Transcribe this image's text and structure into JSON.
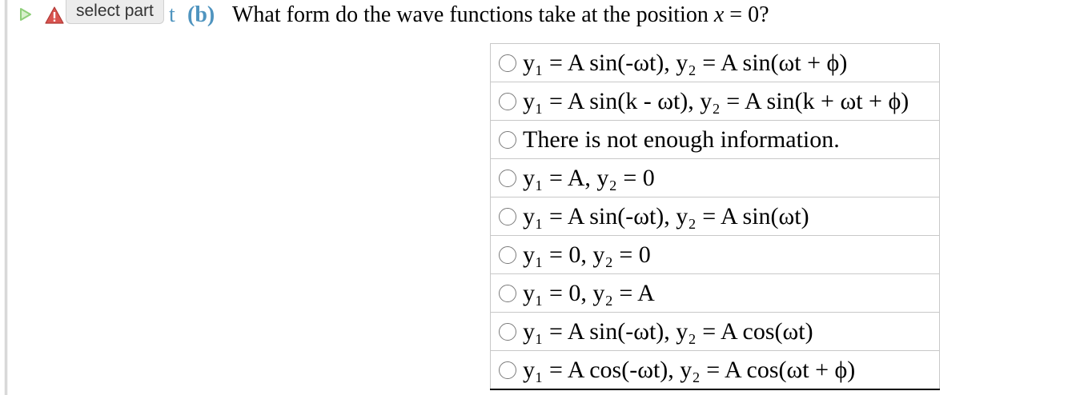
{
  "toolbar": {
    "expand_icon": "play-triangle-icon",
    "warning_icon": "warning-icon",
    "select_part_label": "select part",
    "part_hidden_text": "t",
    "part_label": "(b)"
  },
  "question": {
    "text_before_var": "What form do the wave functions take at the position ",
    "var": "x",
    "text_after_var": " = 0?"
  },
  "options": [
    "y₁ = A sin(-ωt), y₂ = A sin(ωt + ϕ)",
    "y₁ = A sin(k - ωt), y₂ = A sin(k + ωt + ϕ)",
    "There is not enough information.",
    "y₁ = A, y₂ = 0",
    "y₁ = A sin(-ωt), y₂ = A sin(ωt)",
    "y₁ = 0, y₂ = 0",
    "y₁ = 0, y₂ = A",
    "y₁ = A sin(-ωt), y₂ = A cos(ωt)",
    "y₁ = A cos(-ωt), y₂ = A cos(ωt + ϕ)"
  ],
  "colors": {
    "accent_blue": "#4f94bf",
    "expand_green": "#8fcf7a",
    "warning_red": "#d9534f"
  }
}
